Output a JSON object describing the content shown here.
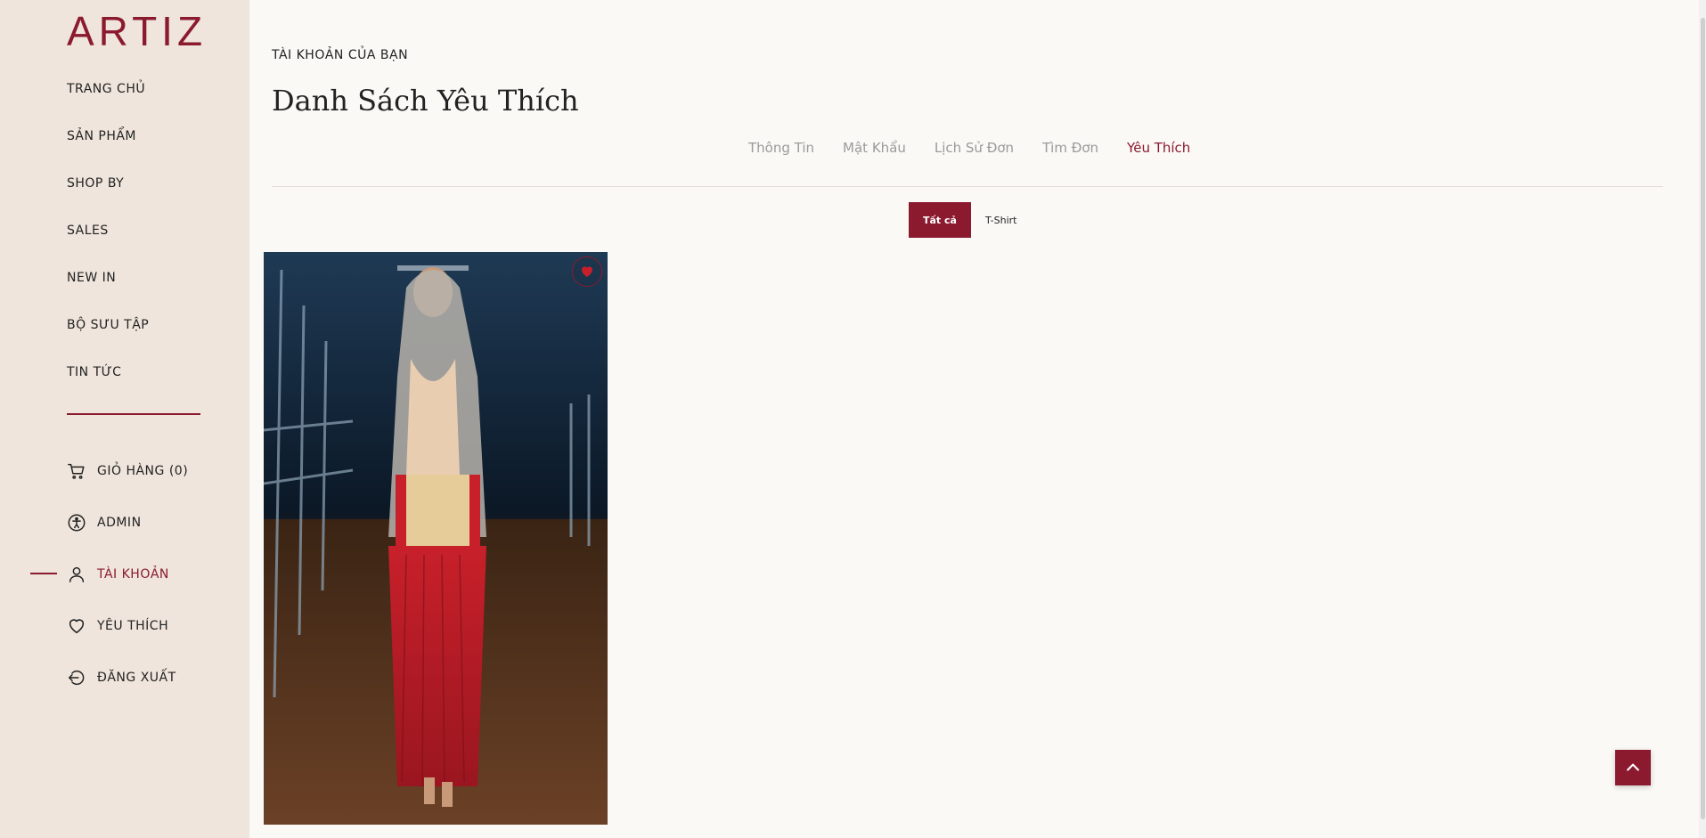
{
  "brand": {
    "logo": "ARTIZ"
  },
  "sidebar": {
    "nav": [
      "TRANG CHỦ",
      "SẢN PHẨM",
      "SHOP BY",
      "SALES",
      "NEW IN",
      "BỘ SƯU TẬP",
      "TIN TỨC"
    ],
    "account": [
      {
        "label": "GIỎ HÀNG (0)",
        "icon": "cart-icon"
      },
      {
        "label": "ADMIN",
        "icon": "accessibility-icon"
      },
      {
        "label": "TÀI KHOẢN",
        "icon": "user-icon"
      },
      {
        "label": "YÊU THÍCH",
        "icon": "heart-icon"
      },
      {
        "label": "ĐĂNG XUẤT",
        "icon": "logout-icon"
      }
    ],
    "active_item": "TÀI KHOẢN"
  },
  "main": {
    "breadcrumb": "TÀI KHOẢN CỦA BẠN",
    "title": "Danh Sách Yêu Thích",
    "tabs": [
      "Thông Tin",
      "Mật Khẩu",
      "Lịch Sử Đơn",
      "Tìm Đơn",
      "Yêu Thích"
    ],
    "active_tab": "Yêu Thích",
    "filters": [
      "Tất cả",
      "T-Shirt"
    ],
    "active_filter": "Tất cả"
  },
  "colors": {
    "accent": "#8b1a2e",
    "sidebar_bg": "#efe5dc",
    "page_bg": "#fbf9f6"
  }
}
